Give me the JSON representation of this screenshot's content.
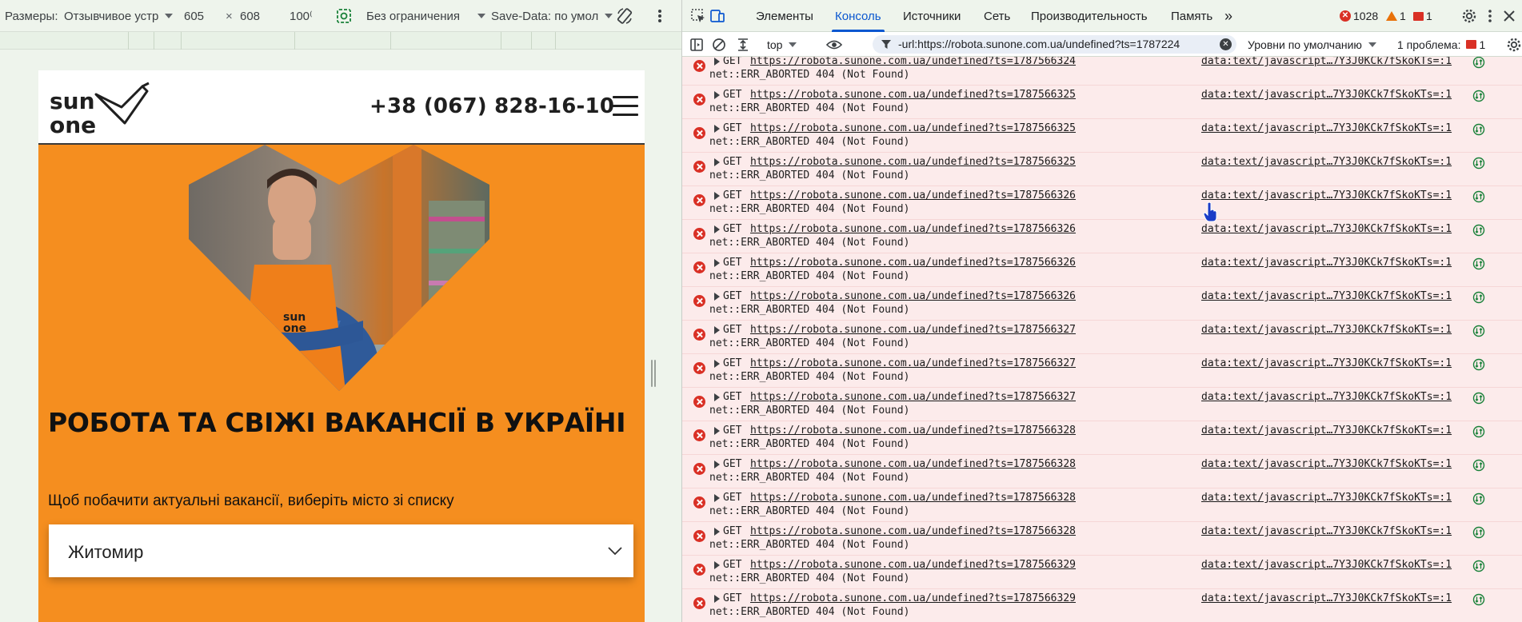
{
  "device_toolbar": {
    "dimensions_label": "Размеры:",
    "device": "Отзывчивое устр",
    "width": "605",
    "times": "×",
    "height": "608",
    "zoom": "100⁽",
    "throttling": "Без ограничения",
    "save_data": "Save-Data: по умол"
  },
  "site": {
    "logo_text": [
      "sun",
      "one"
    ],
    "phone": "+38 (067) 828-16-10",
    "hero_title": "РОБОТА ТА СВІЖІ ВАКАНСІЇ В УКРАЇНІ",
    "hero_subtitle": "Щоб побачити актуальні вакансії, виберіть місто зі списку",
    "city_value": "Житомир",
    "apron_logo": [
      "sun",
      "one"
    ]
  },
  "devtools": {
    "tabs": [
      {
        "label": "Элементы"
      },
      {
        "label": "Консоль",
        "active": true
      },
      {
        "label": "Источники"
      },
      {
        "label": "Сеть"
      },
      {
        "label": "Производительность"
      },
      {
        "label": "Память"
      }
    ],
    "more_tabs": "»",
    "errors_count": "1028",
    "warnings_count": "1",
    "issues_badge_count": "1",
    "console_toolbar": {
      "context": "top",
      "filter_value": "-url:https://robota.sunone.com.ua/undefined?ts=1787224",
      "levels": "Уровни по умолчанию",
      "issues_text": "1 проблема:",
      "issues_count": "1"
    },
    "log_message": "net::ERR_ABORTED 404 (Not Found)",
    "log_method": "GET",
    "log_source": "data:text/javascript…7Y3J0KCk7fSkoKTs=:1",
    "logs": [
      {
        "url": "https://robota.sunone.com.ua/undefined?ts=1787566324"
      },
      {
        "url": "https://robota.sunone.com.ua/undefined?ts=1787566325"
      },
      {
        "url": "https://robota.sunone.com.ua/undefined?ts=1787566325"
      },
      {
        "url": "https://robota.sunone.com.ua/undefined?ts=1787566325"
      },
      {
        "url": "https://robota.sunone.com.ua/undefined?ts=1787566326"
      },
      {
        "url": "https://robota.sunone.com.ua/undefined?ts=1787566326"
      },
      {
        "url": "https://robota.sunone.com.ua/undefined?ts=1787566326"
      },
      {
        "url": "https://robota.sunone.com.ua/undefined?ts=1787566326"
      },
      {
        "url": "https://robota.sunone.com.ua/undefined?ts=1787566327"
      },
      {
        "url": "https://robota.sunone.com.ua/undefined?ts=1787566327"
      },
      {
        "url": "https://robota.sunone.com.ua/undefined?ts=1787566327"
      },
      {
        "url": "https://robota.sunone.com.ua/undefined?ts=1787566328"
      },
      {
        "url": "https://robota.sunone.com.ua/undefined?ts=1787566328"
      },
      {
        "url": "https://robota.sunone.com.ua/undefined?ts=1787566328"
      },
      {
        "url": "https://robota.sunone.com.ua/undefined?ts=1787566328"
      },
      {
        "url": "https://robota.sunone.com.ua/undefined?ts=1787566329"
      },
      {
        "url": "https://robota.sunone.com.ua/undefined?ts=1787566329"
      }
    ]
  },
  "colors": {
    "accent": "#f58e1f",
    "devtools_blue": "#0b57d0",
    "error_red": "#d93025",
    "error_row_bg": "#fcebeb",
    "warning_orange": "#e8710a"
  }
}
